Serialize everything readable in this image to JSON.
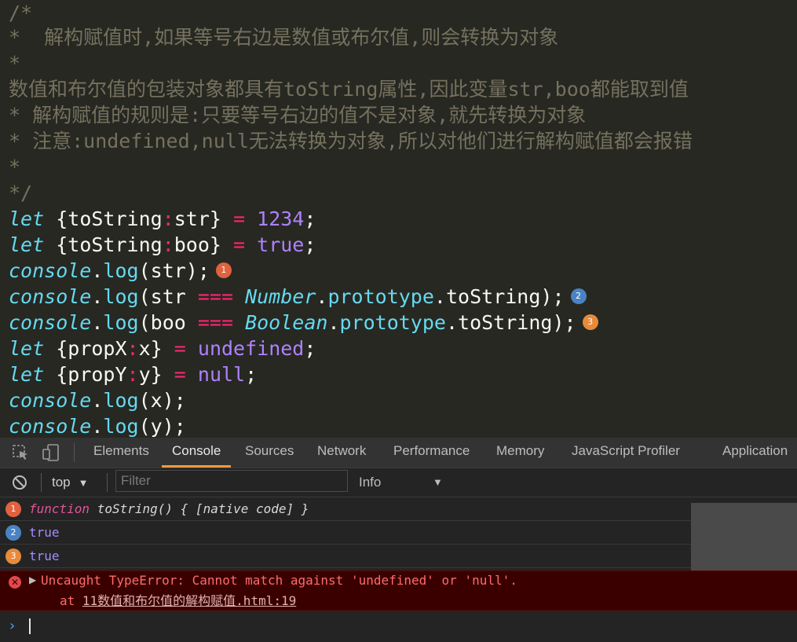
{
  "editor": {
    "comment_lines": [
      "/*",
      "*  解构赋值时,如果等号右边是数值或布尔值,则会转换为对象",
      "*",
      "数值和布尔值的包装对象都具有toString属性,因此变量str,boo都能取到值",
      "* 解构赋值的规则是:只要等号右边的值不是对象,就先转换为对象",
      "* 注意:undefined,null无法转换为对象,所以对他们进行解构赋值都会报错",
      "*",
      "*/"
    ],
    "code": {
      "let": "let",
      "console": "console",
      "log": "log",
      "tostring": "toString",
      "str": "str",
      "boo": "boo",
      "num_1234": "1234",
      "true": "true",
      "number": "Number",
      "boolean": "Boolean",
      "prototype": "prototype",
      "propx": "propX",
      "propy": "propY",
      "x": "x",
      "y": "y",
      "undefined": "undefined",
      "null": "null"
    },
    "markers": [
      "1",
      "2",
      "3"
    ]
  },
  "devtools": {
    "tabs": [
      "Elements",
      "Console",
      "Sources",
      "Network",
      "Performance",
      "Memory",
      "JavaScript Profiler",
      "Application"
    ],
    "active_tab": "Console",
    "context": "top",
    "filter_placeholder": "Filter",
    "level": "Info",
    "logs": [
      {
        "marker": "1",
        "text": "function toString() { [native code] }"
      },
      {
        "marker": "2",
        "text": "true"
      },
      {
        "marker": "3",
        "text": "true"
      }
    ],
    "error": {
      "message": "Uncaught TypeError: Cannot match against 'undefined' or 'null'.",
      "at": "at",
      "link": "11数值和布尔值的解构赋值.html:19"
    }
  },
  "colors": {
    "editor_bg": "#272822",
    "comment": "#75715e",
    "keyword": "#66d9ef",
    "operator": "#f92672",
    "constant": "#ae81ff",
    "marker1": "#e0623e",
    "marker2": "#4a83c4",
    "marker3": "#e88a3b",
    "active_tab_underline": "#f09a3a",
    "error_bg": "#3a0000",
    "error_text": "#ff6b6b"
  }
}
